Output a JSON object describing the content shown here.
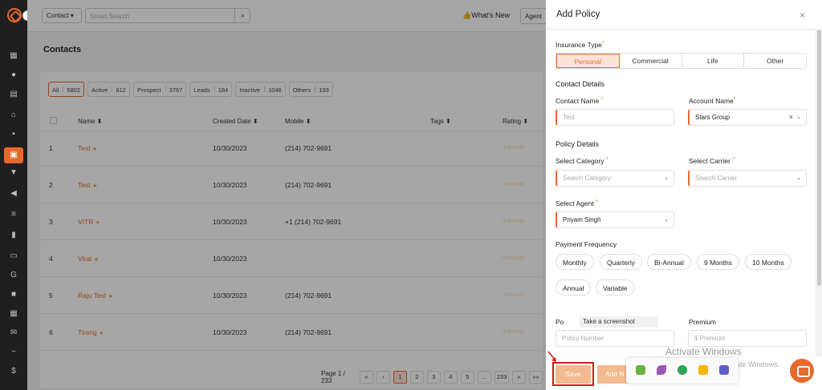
{
  "topbar": {
    "contact_select": "Contact",
    "search_placeholder": "Smart Search",
    "whats_new": "What's New",
    "agent_button": "Agent"
  },
  "page": {
    "title": "Contacts"
  },
  "filters": [
    {
      "label": "All",
      "count": "5802"
    },
    {
      "label": "Active",
      "count": "612"
    },
    {
      "label": "Prospect",
      "count": "3767"
    },
    {
      "label": "Leads",
      "count": "184"
    },
    {
      "label": "Inactive",
      "count": "1046"
    },
    {
      "label": "Others",
      "count": "193"
    }
  ],
  "table": {
    "headers": {
      "name": "Name",
      "created": "Created Date",
      "mobile": "Mobile",
      "tags": "Tags",
      "rating": "Rating"
    },
    "rows": [
      {
        "no": "1",
        "name": "Test",
        "date": "10/30/2023",
        "mobile": "(214) 702-9691"
      },
      {
        "no": "2",
        "name": "Test",
        "date": "10/30/2023",
        "mobile": "(214) 702-9691"
      },
      {
        "no": "3",
        "name": "VITR",
        "date": "10/30/2023",
        "mobile": "+1 (214) 702-9691"
      },
      {
        "no": "4",
        "name": "Virat",
        "date": "10/30/2023",
        "mobile": ""
      },
      {
        "no": "5",
        "name": "Raju Test",
        "date": "10/30/2023",
        "mobile": "(214) 702-9691"
      },
      {
        "no": "6",
        "name": "Tirang",
        "date": "10/30/2023",
        "mobile": "(214) 702-9691"
      }
    ]
  },
  "pager": {
    "info": "Page 1 / 233",
    "first": "«",
    "prev": "‹",
    "pages": [
      "1",
      "2",
      "3",
      "4",
      "5",
      "...",
      "233"
    ],
    "next": "»",
    "last": "»»"
  },
  "panel": {
    "title": "Add Policy",
    "close": "×",
    "insurance_type_label": "Insurance Type",
    "insurance_types": [
      "Personal",
      "Commercial",
      "Life",
      "Other"
    ],
    "contact_details": "Contact Details",
    "contact_name_label": "Contact Name",
    "contact_name_value": "Test",
    "account_name_label": "Account Name",
    "account_name_value": "Stars Group",
    "policy_details": "Policy Details",
    "category_label": "Select Category",
    "category_placeholder": "Search Category",
    "carrier_label": "Select Carrier",
    "carrier_placeholder": "Search Carrier",
    "agent_label": "Select Agent",
    "agent_value": "Priyam Singh",
    "payment_frequency": "Payment Frequency",
    "frequencies": [
      "Monthly",
      "Quarterly",
      "Bi-Annual",
      "9 Months",
      "10 Months",
      "Annual",
      "Variable"
    ],
    "policy_number_label": "Po",
    "policy_number_placeholder": "Policy Number",
    "premium_label": "Premium",
    "premium_placeholder": "$ Premium",
    "save": "Save",
    "add_new": "Add N"
  },
  "tooltip": "Take a screenshot",
  "watermark": {
    "line1": "Activate Windows",
    "line2": "Go to Settings to activate Windows."
  },
  "colors": {
    "accent": "#e8692d",
    "highlight": "#d61a1a"
  }
}
